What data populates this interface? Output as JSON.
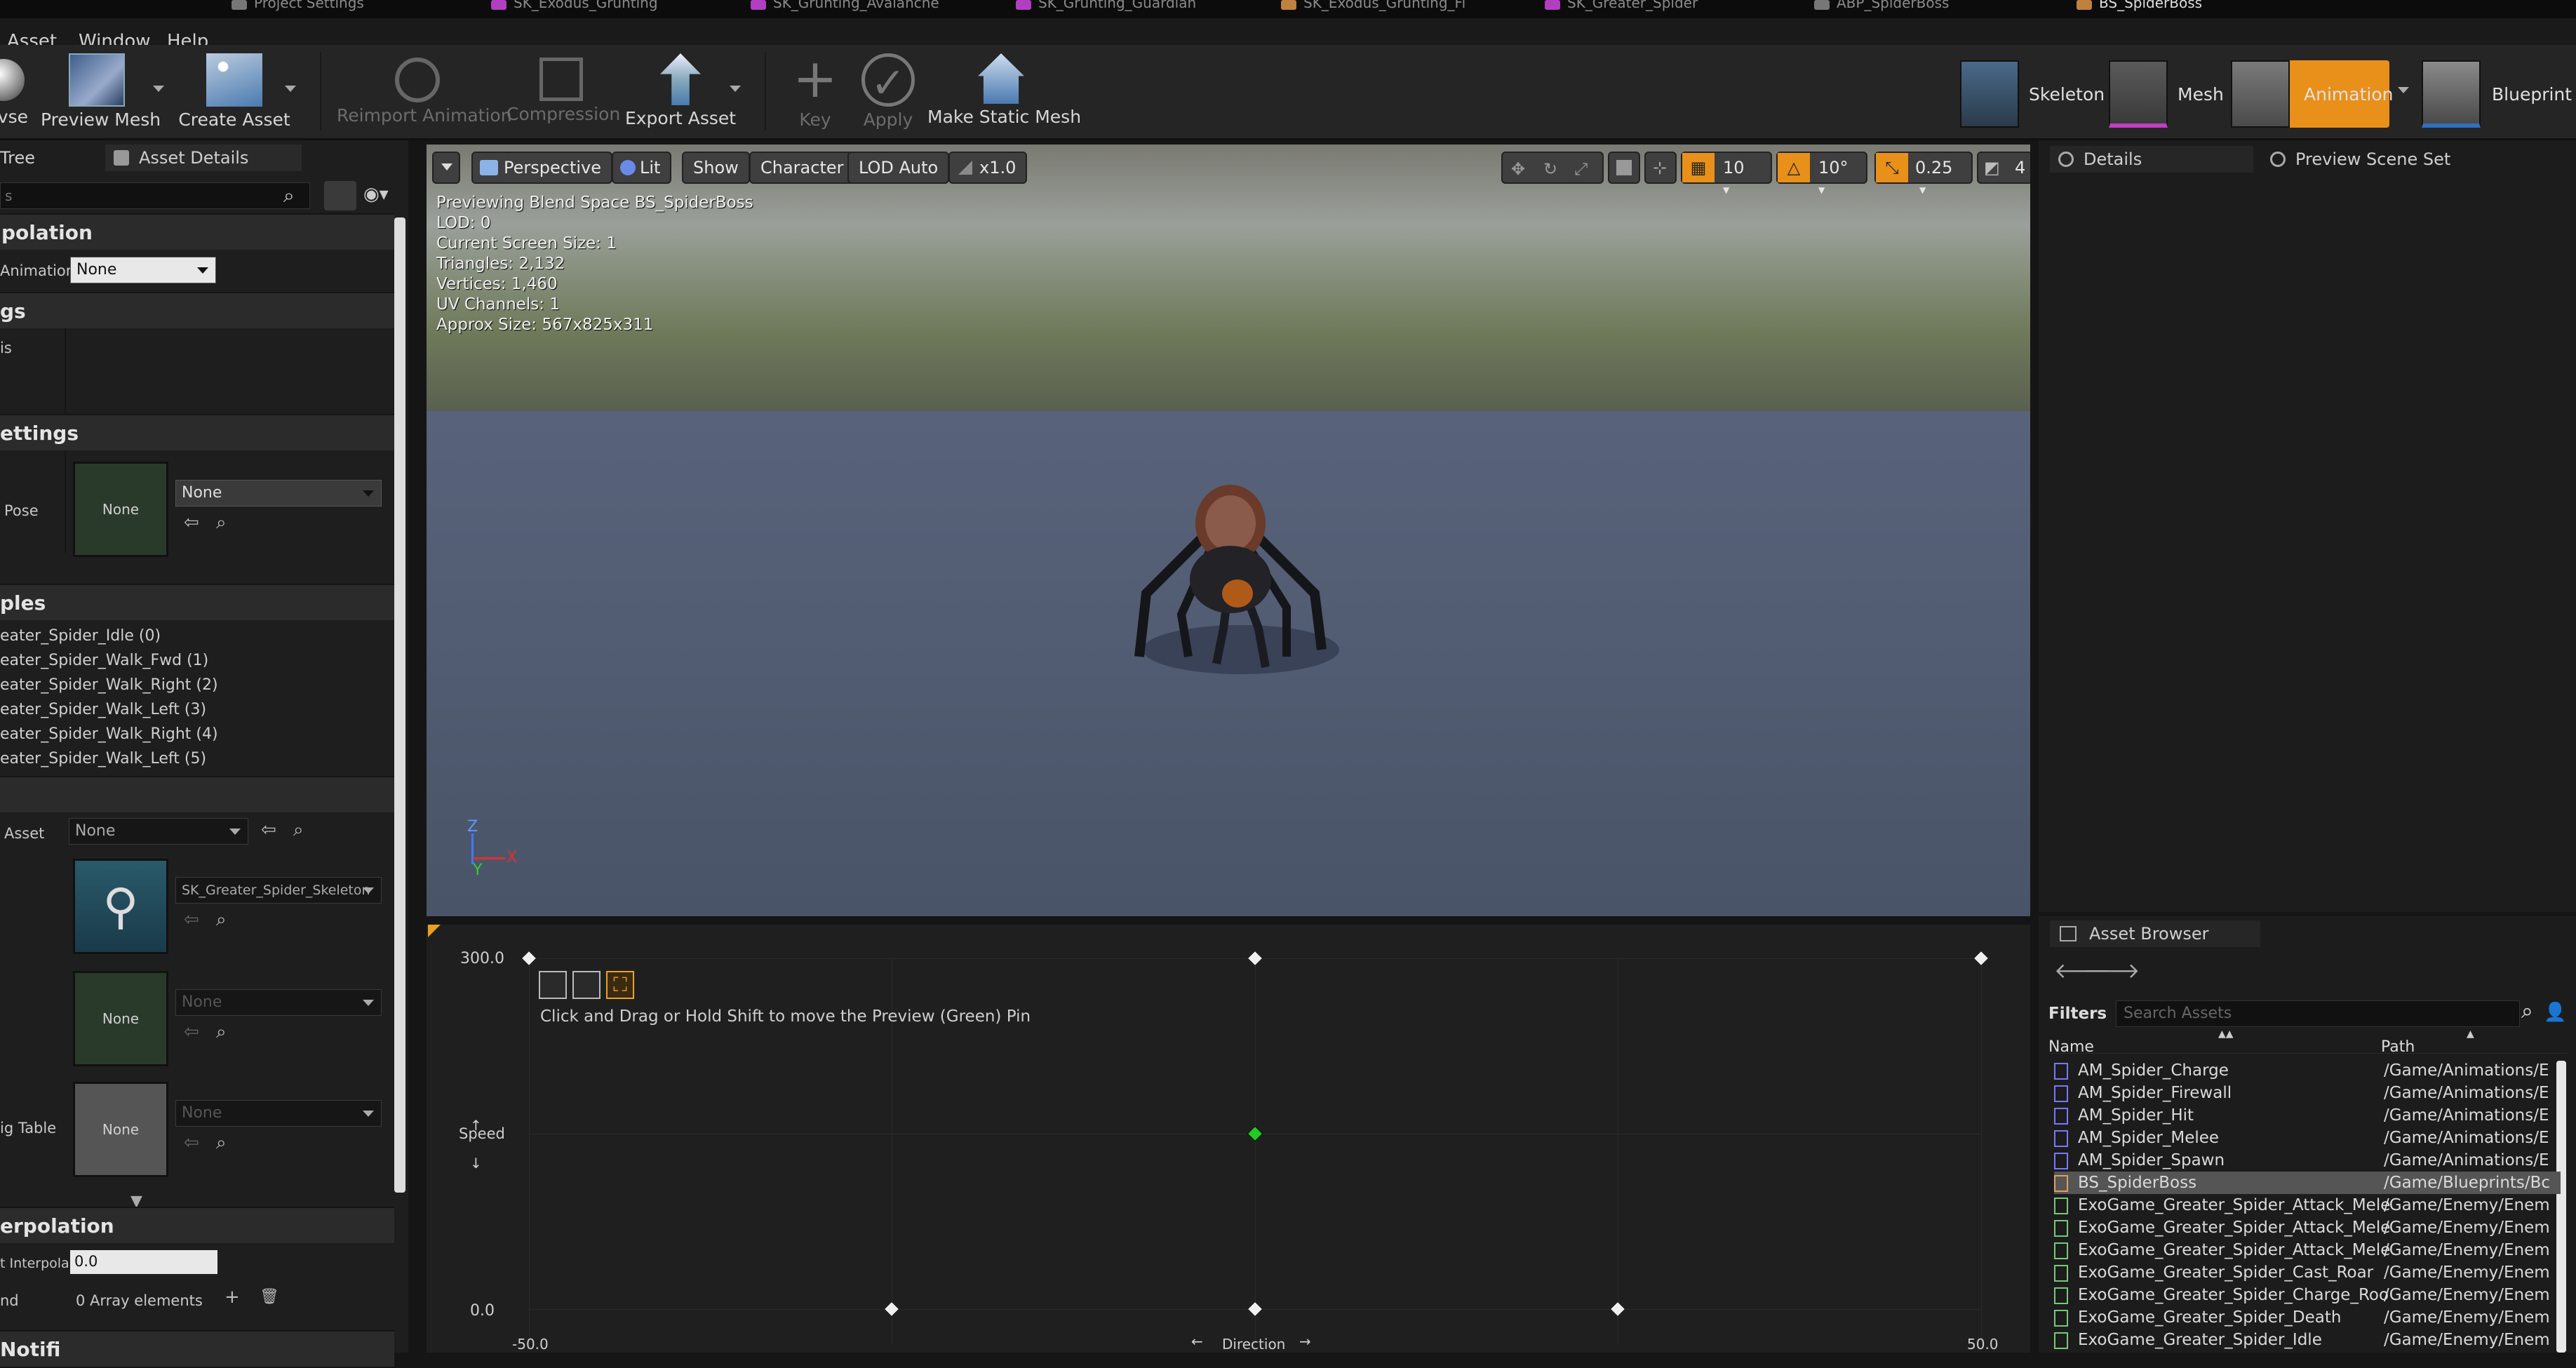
{
  "doc_tabs": [
    {
      "label": "Project Settings",
      "color": "#777777"
    },
    {
      "label": "SK_Exodus_Grunting",
      "color": "#b040c0"
    },
    {
      "label": "SK_Grunting_Avalanche",
      "color": "#b040c0"
    },
    {
      "label": "SK_Grunting_Guardian",
      "color": "#b040c0"
    },
    {
      "label": "SK_Exodus_Grunting_Fi",
      "color": "#c08040"
    },
    {
      "label": "SK_Greater_Spider",
      "color": "#b040c0"
    },
    {
      "label": "ABP_SpiderBoss",
      "color": "#777777"
    },
    {
      "label": "BS_SpiderBoss",
      "color": "#c08040"
    }
  ],
  "menu": {
    "asset": "Asset",
    "window": "Window",
    "help": "Help"
  },
  "toolbar": {
    "preview_mesh": "Preview Mesh",
    "create_asset": "Create Asset",
    "reimport_animation": "Reimport Animation",
    "compression": "Compression",
    "export_asset": "Export Asset",
    "key": "Key",
    "apply": "Apply",
    "make_static_mesh": "Make Static Mesh",
    "partial_left": "vse"
  },
  "modes": {
    "skeleton": "Skeleton",
    "mesh": "Mesh",
    "animation": "Animation",
    "blueprint": "Blueprint"
  },
  "left_panel": {
    "tab_tree": "Tree",
    "tab_asset_details": "Asset Details",
    "search_text": "s",
    "cat_interpolation": "polation",
    "animation_label": "Animatior",
    "animation_value": "None",
    "cat_tags": "gs",
    "tags_row": "is",
    "cat_settings": "ettings",
    "pose_label": "Pose",
    "pose_thumb": "None",
    "pose_value": "None",
    "cat_samples": "ples",
    "samples": [
      "eater_Spider_Idle (0)",
      "eater_Spider_Walk_Fwd (1)",
      "eater_Spider_Walk_Right (2)",
      "eater_Spider_Walk_Left (3)",
      "eater_Spider_Walk_Right (4)",
      "eater_Spider_Walk_Left (5)"
    ],
    "asset_label": "Asset",
    "asset_value": "None",
    "skeleton_value": "SK_Greater_Spider_Skeleton",
    "thumb2": "None",
    "value2": "None",
    "thumb3": "None",
    "value3": "None",
    "table_label": "ig Table",
    "cat_interp2": "erpolation",
    "interp_label": "t Interpola",
    "interp_value": "0.0",
    "nd_label": "nd",
    "array_text": "0 Array elements",
    "cat_notifies": "Notifi"
  },
  "viewport": {
    "perspective": "Perspective",
    "lit": "Lit",
    "show": "Show",
    "character": "Character",
    "lod": "LOD Auto",
    "speed": "x1.0",
    "grid_snap": "10",
    "rot_snap": "10°",
    "scale_snap": "0.25",
    "cam_speed": "4",
    "stats": [
      "Previewing Blend Space BS_SpiderBoss",
      "LOD: 0",
      "Current Screen Size: 1",
      "Triangles: 2,132",
      "Vertices: 1,460",
      "UV Channels: 1",
      "Approx Size: 567x825x311"
    ],
    "axis_z": "Z",
    "axis_y": "Y",
    "axis_x": "X"
  },
  "blendspace": {
    "hint": "Click and Drag or Hold Shift to move the Preview (Green) Pin",
    "y_max": "300.0",
    "y_min": "0.0",
    "y_name": "Speed",
    "x_min": "-50.0",
    "x_max": "50.0",
    "x_name": "Direction",
    "preview_pin": {
      "direction": 0,
      "speed": 150
    }
  },
  "right_panel": {
    "tab_details": "Details",
    "tab_preview_scene": "Preview Scene Set"
  },
  "asset_browser": {
    "tab": "Asset Browser",
    "filters": "Filters",
    "search_placeholder": "Search Assets",
    "col_name": "Name",
    "col_path": "Path",
    "rows": [
      {
        "name": "AM_Spider_Charge",
        "path": "/Game/Animations/E",
        "color": "#7878ff"
      },
      {
        "name": "AM_Spider_Firewall",
        "path": "/Game/Animations/E",
        "color": "#7878ff"
      },
      {
        "name": "AM_Spider_Hit",
        "path": "/Game/Animations/E",
        "color": "#7878ff"
      },
      {
        "name": "AM_Spider_Melee",
        "path": "/Game/Animations/E",
        "color": "#7878ff"
      },
      {
        "name": "AM_Spider_Spawn",
        "path": "/Game/Animations/E",
        "color": "#7878ff"
      },
      {
        "name": "BS_SpiderBoss",
        "path": "/Game/Blueprints/Bc",
        "color": "#e0a060"
      },
      {
        "name": "ExoGame_Greater_Spider_Attack_Mele",
        "path": "/Game/Enemy/Enem",
        "color": "#78c878"
      },
      {
        "name": "ExoGame_Greater_Spider_Attack_Mele",
        "path": "/Game/Enemy/Enem",
        "color": "#78c878"
      },
      {
        "name": "ExoGame_Greater_Spider_Attack_Mele",
        "path": "/Game/Enemy/Enem",
        "color": "#78c878"
      },
      {
        "name": "ExoGame_Greater_Spider_Cast_Roar",
        "path": "/Game/Enemy/Enem",
        "color": "#78c878"
      },
      {
        "name": "ExoGame_Greater_Spider_Charge_Roo",
        "path": "/Game/Enemy/Enem",
        "color": "#78c878"
      },
      {
        "name": "ExoGame_Greater_Spider_Death",
        "path": "/Game/Enemy/Enem",
        "color": "#78c878"
      },
      {
        "name": "ExoGame_Greater_Spider_Idle",
        "path": "/Game/Enemy/Enem",
        "color": "#78c878"
      }
    ]
  },
  "accent": "#f0a020",
  "pin_color": "#22cc22"
}
